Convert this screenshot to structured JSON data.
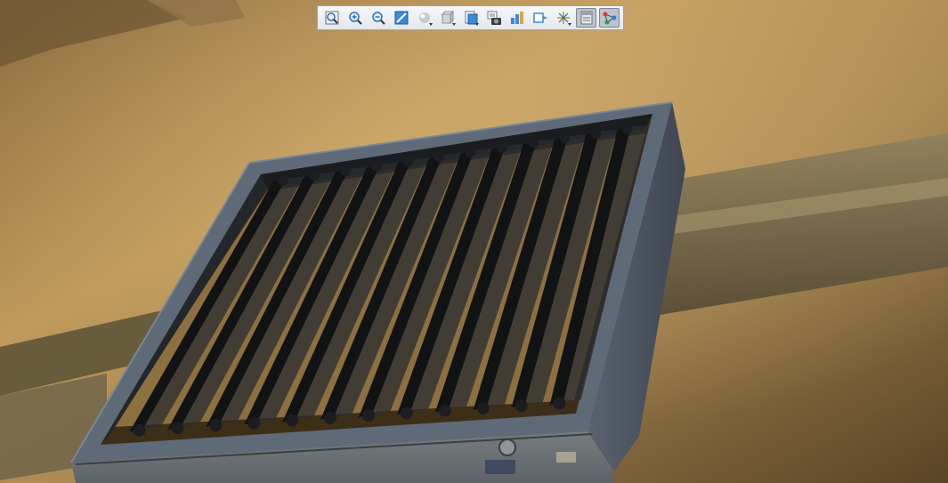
{
  "viewport": {
    "name": "3d-model-viewport"
  },
  "toolbar": {
    "buttons": [
      {
        "name": "zoom-to-fit-button",
        "icon": "zoom-fit-icon",
        "dropdown": false,
        "active": false
      },
      {
        "name": "zoom-in-button",
        "icon": "zoom-in-icon",
        "dropdown": false,
        "active": false
      },
      {
        "name": "zoom-out-button",
        "icon": "zoom-out-icon",
        "dropdown": false,
        "active": false
      },
      {
        "name": "zoom-area-button",
        "icon": "zoom-area-icon",
        "dropdown": false,
        "active": false
      },
      {
        "name": "view-orientation-button",
        "icon": "sphere-icon",
        "dropdown": true,
        "active": false
      },
      {
        "name": "display-style-button",
        "icon": "cube-icon",
        "dropdown": true,
        "active": false
      },
      {
        "name": "section-view-button",
        "icon": "section-icon",
        "dropdown": true,
        "active": false
      },
      {
        "name": "screenshot-button",
        "icon": "camera-icon",
        "dropdown": false,
        "active": false
      },
      {
        "name": "view-settings-button",
        "icon": "view-settings-icon",
        "dropdown": false,
        "active": false
      },
      {
        "name": "exploded-view-button",
        "icon": "explode-icon",
        "dropdown": false,
        "active": false
      },
      {
        "name": "scene-effects-button",
        "icon": "sparkle-icon",
        "dropdown": true,
        "active": false
      },
      {
        "name": "display-pane-button",
        "icon": "display-pane-icon",
        "dropdown": false,
        "active": true
      },
      {
        "name": "network-graph-button",
        "icon": "network-graph-icon",
        "dropdown": false,
        "active": true
      }
    ]
  },
  "colors": {
    "background_light": "#c09a5c",
    "background_dark": "#5a4326",
    "frame": "#5f6a78",
    "frame_dark": "#3c4350",
    "blade": "#111214",
    "accent_blue": "#2a7fd4"
  }
}
